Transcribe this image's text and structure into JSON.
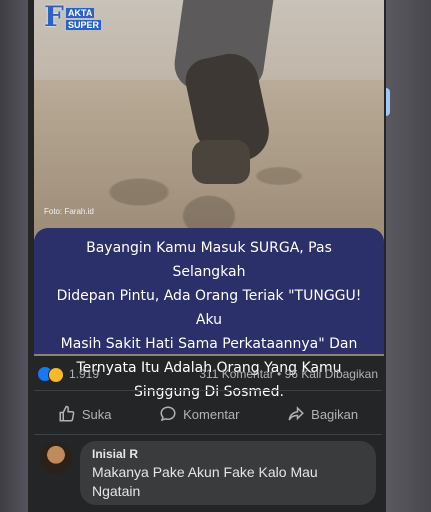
{
  "logo": {
    "f": "F",
    "line1": "AKTA",
    "line2": "SUPER"
  },
  "photo_credit": "Foto: Farah.id",
  "quote_lines": [
    "Bayangin Kamu Masuk SURGA, Pas Selangkah",
    "Didepan Pintu, Ada Orang Teriak \"TUNGGU! Aku",
    "Masih Sakit Hati Sama Perkataannya\" Dan",
    "Ternyata Itu Adalah Orang Yang Kamu",
    "Singgung Di Sosmed."
  ],
  "stats": {
    "reactions": "1.919",
    "comments_shares": "311 Komentar • 96 Kali Dibagikan"
  },
  "actions": {
    "like": "Suka",
    "comment": "Komentar",
    "share": "Bagikan"
  },
  "comment": {
    "author": "Inisial R",
    "lines": [
      "Makanya Pake Akun Fake Kalo Mau",
      "Ngatain"
    ]
  }
}
